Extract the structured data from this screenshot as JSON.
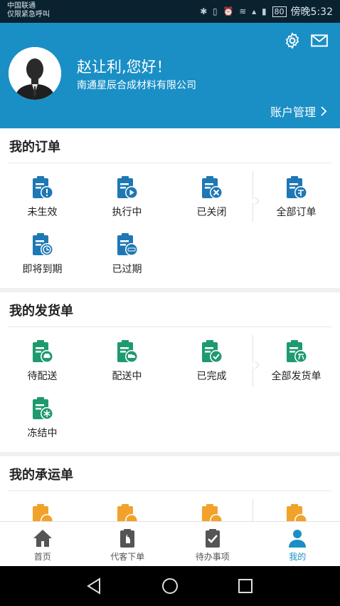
{
  "status_bar": {
    "carrier_line1": "中国联通",
    "carrier_line2": "仅限紧急呼叫",
    "battery": "80",
    "time": "傍晚5:32"
  },
  "header": {
    "greeting": "赵让利,您好！",
    "company": "南通星辰合成材料有限公司",
    "account_label": "账户管理",
    "bg_color": "#1a8fc6"
  },
  "orders": {
    "title": "我的订单",
    "icon_color": "#1e78b4",
    "items": [
      {
        "label": "未生效",
        "icon": "clipboard-exclamation-icon"
      },
      {
        "label": "执行中",
        "icon": "clipboard-play-icon"
      },
      {
        "label": "已关闭",
        "icon": "clipboard-close-icon"
      },
      {
        "label": "全部订单",
        "icon": "clipboard-order-icon"
      },
      {
        "label": "即将到期",
        "icon": "clipboard-clock-icon"
      },
      {
        "label": "已过期",
        "icon": "clipboard-expired-icon"
      }
    ]
  },
  "shipments": {
    "title": "我的发货单",
    "icon_color": "#1e9a6e",
    "items": [
      {
        "label": "待配送",
        "icon": "clipboard-car-icon"
      },
      {
        "label": "配送中",
        "icon": "clipboard-truck-icon"
      },
      {
        "label": "已完成",
        "icon": "clipboard-check-icon"
      },
      {
        "label": "全部发货单",
        "icon": "clipboard-ship-icon"
      },
      {
        "label": "冻结中",
        "icon": "clipboard-snowflake-icon"
      }
    ]
  },
  "carriage": {
    "title": "我的承运单",
    "icon_color": "#f2a22a"
  },
  "tabbar": {
    "items": [
      {
        "label": "首页",
        "icon": "home-icon"
      },
      {
        "label": "代客下单",
        "icon": "clipboard-hand-icon"
      },
      {
        "label": "待办事项",
        "icon": "clipboard-check-icon"
      },
      {
        "label": "我的",
        "icon": "person-icon"
      }
    ]
  }
}
